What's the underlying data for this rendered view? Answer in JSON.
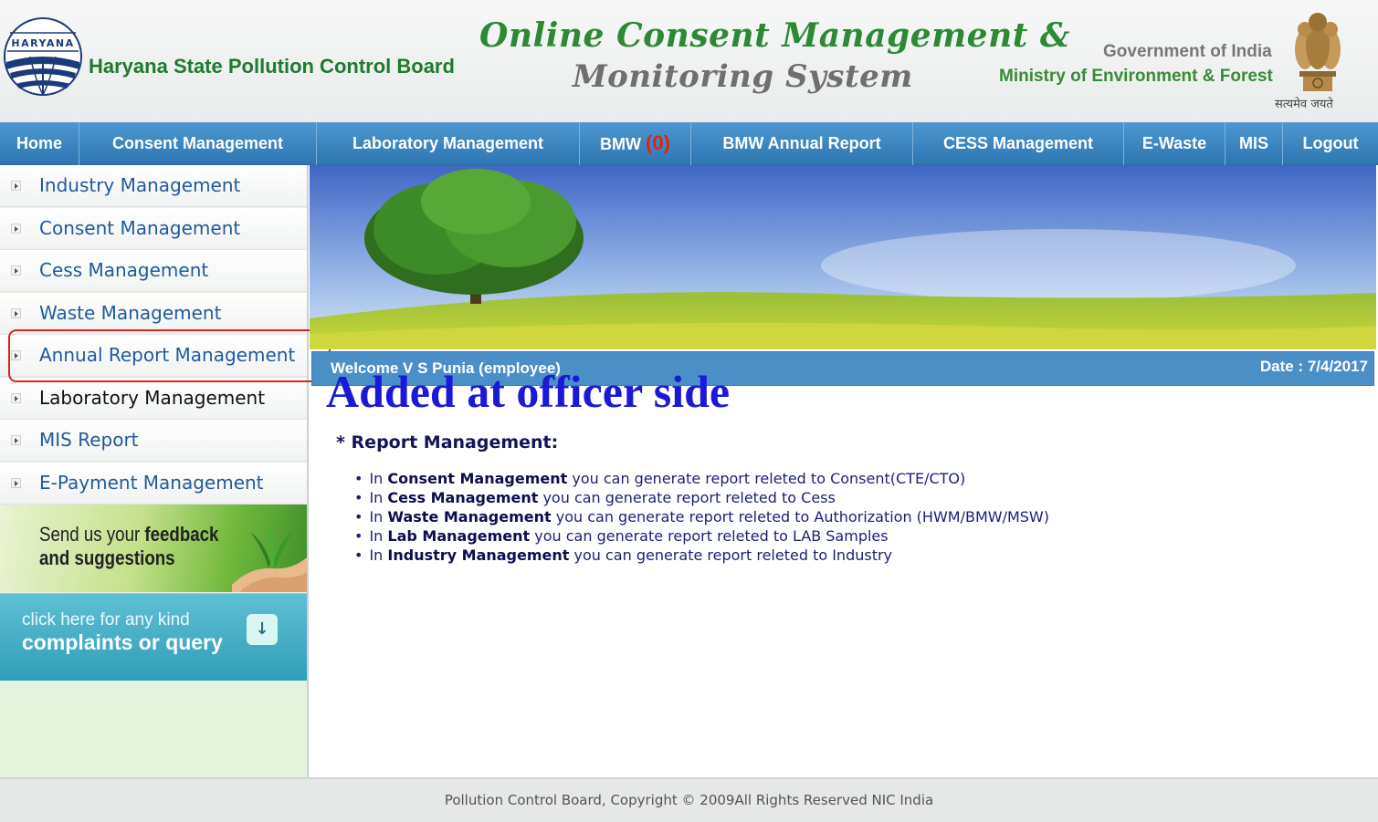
{
  "header": {
    "logo_text": "HARYANA",
    "board_name": "Haryana State Pollution Control Board",
    "title_line1": "Online Consent Management &",
    "title_line2": "Monitoring System",
    "government": "Government of India",
    "ministry": "Ministry of Environment & Forest",
    "motto": "सत्यमेव जयते"
  },
  "nav": {
    "items": [
      {
        "label": "Home"
      },
      {
        "label": "Consent Management"
      },
      {
        "label": "Laboratory Management"
      },
      {
        "label": "BMW",
        "count": "(0)"
      },
      {
        "label": "BMW Annual Report"
      },
      {
        "label": "CESS Management"
      },
      {
        "label": "E-Waste"
      },
      {
        "label": "MIS"
      },
      {
        "label": "Logout"
      }
    ]
  },
  "sidebar": {
    "items": [
      {
        "label": "Industry Management"
      },
      {
        "label": "Consent Management"
      },
      {
        "label": "Cess Management"
      },
      {
        "label": "Waste Management"
      },
      {
        "label": "Annual Report Management"
      },
      {
        "label": "Laboratory Management"
      },
      {
        "label": "MIS Report"
      },
      {
        "label": "E-Payment Management"
      }
    ],
    "feedback_line1_prefix": "Send us your ",
    "feedback_line1_bold": "feedback",
    "feedback_line2": "and suggestions",
    "complaints_line1": "click here for any kind",
    "complaints_line2": "complaints or query"
  },
  "main": {
    "welcome": "Welcome V S Punia (employee)",
    "date": "Date : 7/4/2017",
    "annotation": "Added at officer side",
    "report_title": "* Report Management:",
    "report_items": [
      {
        "prefix": "In ",
        "bold": "Consent Management",
        "rest": " you can generate report releted to Consent(CTE/CTO)"
      },
      {
        "prefix": "In ",
        "bold": "Cess Management",
        "rest": " you can generate report releted to Cess"
      },
      {
        "prefix": "In ",
        "bold": "Waste Management",
        "rest": " you can generate report releted to Authorization (HWM/BMW/MSW)"
      },
      {
        "prefix": "In ",
        "bold": "Lab Management",
        "rest": " you can generate report releted to LAB Samples"
      },
      {
        "prefix": "In ",
        "bold": "Industry Management",
        "rest": " you can generate report releted to Industry"
      }
    ]
  },
  "footer": {
    "copyright": "Pollution Control Board, Copyright © 2009All Rights Reserved NIC India"
  },
  "colors": {
    "nav_blue": "#3a83c0",
    "link_blue": "#1f5a9c",
    "highlight_red": "#e0201a",
    "annotation_blue": "#1a1ad6",
    "title_green": "#2c8a35"
  }
}
